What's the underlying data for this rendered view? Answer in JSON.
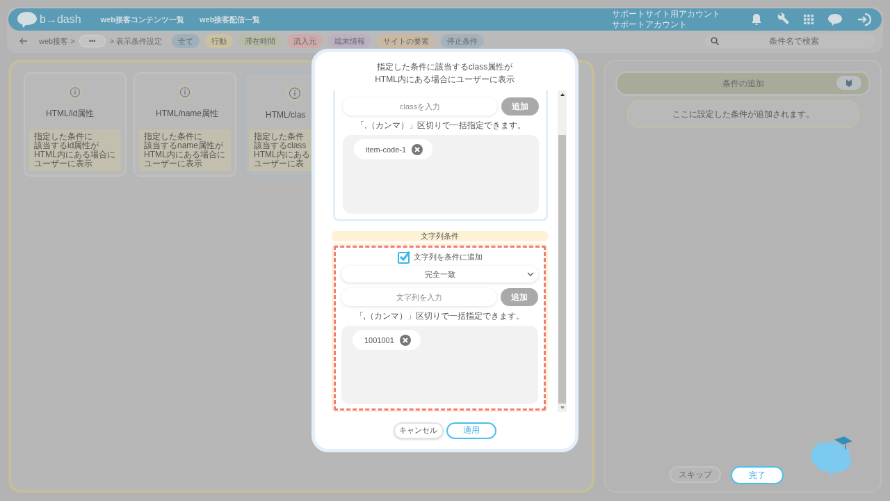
{
  "header": {
    "logo": "b→dash",
    "nav": [
      "web接客コンテンツ一覧",
      "web接客配信一覧"
    ],
    "account": [
      "サポートサイト用アカウント",
      "サポートアカウント"
    ]
  },
  "toolbar": {
    "breadcrumb": [
      {
        "kind": "text",
        "label": "web接客 >"
      },
      {
        "kind": "more",
        "label": "•••"
      },
      {
        "kind": "text",
        "label": "> 表示条件設定"
      }
    ],
    "filters": [
      {
        "label": "全て",
        "color": "#9fb0bd"
      },
      {
        "label": "行動",
        "color": "#c9c19f"
      },
      {
        "label": "滞在時間",
        "color": "#b7bca6"
      },
      {
        "label": "流入元",
        "color": "#cfaaaa"
      },
      {
        "label": "端末情報",
        "color": "#bcb1c3"
      },
      {
        "label": "サイトの要素",
        "color": "#c9b9a3"
      },
      {
        "label": "停止条件",
        "color": "#a5b2bc"
      }
    ],
    "search": {
      "placeholder": "条件名で検索"
    }
  },
  "condition_cards": [
    {
      "title": "HTML/id属性",
      "description": [
        "指定した条件に",
        "該当するid属性が",
        "HTML内にある場合に",
        "ユーザーに表示"
      ],
      "selected": false
    },
    {
      "title": "HTML/name属性",
      "description": [
        "指定した条件に",
        "該当するname属性が",
        "HTML内にある場合に",
        "ユーザーに表示"
      ],
      "selected": false
    },
    {
      "title": "HTML/clas",
      "description": [
        "指定した条件",
        "該当するclass",
        "HTML内にある",
        "ユーザーに表"
      ],
      "selected": true
    }
  ],
  "modal": {
    "description": [
      "指定した条件に該当するclass属性が",
      "HTML内にある場合にユーザーに表示"
    ],
    "sections": [
      {
        "input_placeholder": "classを入力",
        "add_button": "追加",
        "hint": "「,（カンマ）」区切りで一括指定できます。",
        "tags": [
          "item-code-1"
        ],
        "highlighted": false
      },
      {
        "title": "文字列条件",
        "checkbox": {
          "label": "文字列を条件に追加",
          "checked": true
        },
        "match": "完全一致",
        "input_placeholder": "文字列を入力",
        "add_button": "追加",
        "hint": "「,（カンマ）」区切りで一括指定できます。",
        "tags": [
          "1001001"
        ],
        "highlighted": true
      }
    ],
    "cancel_button": "キャンセル",
    "apply_button": "適用"
  },
  "right_panel": {
    "title": "条件の追加",
    "note": "ここに設定した条件が追加されます。",
    "skip_button": "スキップ",
    "done_button": "完了"
  }
}
